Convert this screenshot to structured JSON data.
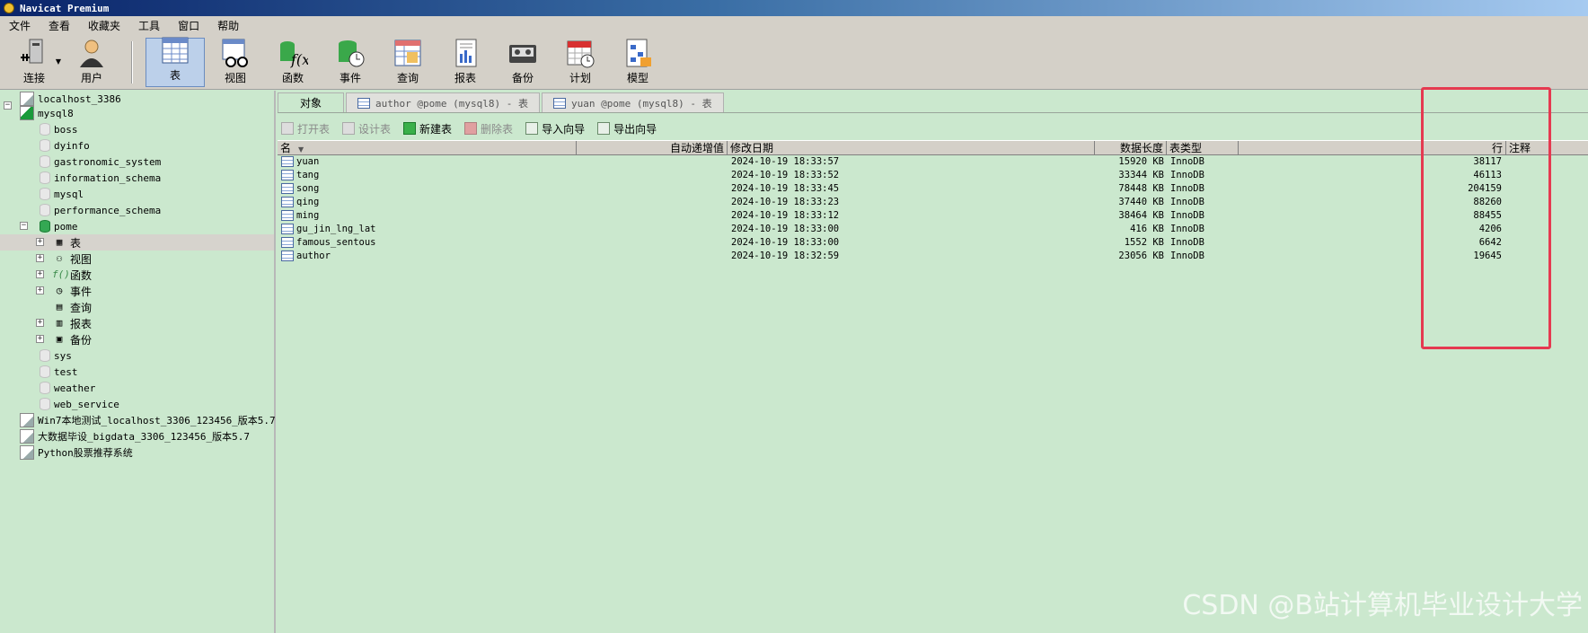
{
  "window": {
    "title": "Navicat Premium"
  },
  "menu": [
    "文件",
    "查看",
    "收藏夹",
    "工具",
    "窗口",
    "帮助"
  ],
  "toolbar": {
    "buttons": [
      {
        "label": "连接",
        "icon": "connection-icon"
      },
      {
        "label": "用户",
        "icon": "user-icon"
      },
      {
        "label": "表",
        "icon": "table-icon"
      },
      {
        "label": "视图",
        "icon": "view-icon"
      },
      {
        "label": "函数",
        "icon": "function-icon"
      },
      {
        "label": "事件",
        "icon": "event-icon"
      },
      {
        "label": "查询",
        "icon": "query-icon"
      },
      {
        "label": "报表",
        "icon": "report-icon"
      },
      {
        "label": "备份",
        "icon": "backup-icon"
      },
      {
        "label": "计划",
        "icon": "schedule-icon"
      },
      {
        "label": "模型",
        "icon": "model-icon"
      }
    ],
    "active": "表"
  },
  "sidebar": {
    "connections": [
      {
        "label": "localhost_3386"
      },
      {
        "label": "mysql8"
      },
      {
        "label": "Win7本地测试_localhost_3306_123456_版本5.7"
      },
      {
        "label": "大数据毕设_bigdata_3306_123456_版本5.7"
      },
      {
        "label": "Python股票推荐系统"
      }
    ],
    "databases": [
      "boss",
      "dyinfo",
      "gastronomic_system",
      "information_schema",
      "mysql",
      "performance_schema",
      "pome",
      "sys",
      "test",
      "weather",
      "web_service"
    ],
    "pome_children": [
      "表",
      "视图",
      "函数",
      "事件",
      "查询",
      "报表",
      "备份"
    ]
  },
  "tabs": {
    "objects": "对象",
    "tab1": "author @pome (mysql8) - 表",
    "tab2": "yuan @pome (mysql8) - 表"
  },
  "object_toolbar": {
    "open": "打开表",
    "design": "设计表",
    "new": "新建表",
    "delete": "删除表",
    "import": "导入向导",
    "export": "导出向导"
  },
  "grid": {
    "headers": {
      "name": "名",
      "auto_inc": "自动递增值",
      "modified": "修改日期",
      "data_length": "数据长度",
      "engine": "表类型",
      "rows": "行",
      "comment": "注释"
    },
    "rows": [
      {
        "name": "yuan",
        "modified": "2024-10-19 18:33:57",
        "data_length": "15920 KB",
        "engine": "InnoDB",
        "rows": "38117"
      },
      {
        "name": "tang",
        "modified": "2024-10-19 18:33:52",
        "data_length": "33344 KB",
        "engine": "InnoDB",
        "rows": "46113"
      },
      {
        "name": "song",
        "modified": "2024-10-19 18:33:45",
        "data_length": "78448 KB",
        "engine": "InnoDB",
        "rows": "204159"
      },
      {
        "name": "qing",
        "modified": "2024-10-19 18:33:23",
        "data_length": "37440 KB",
        "engine": "InnoDB",
        "rows": "88260"
      },
      {
        "name": "ming",
        "modified": "2024-10-19 18:33:12",
        "data_length": "38464 KB",
        "engine": "InnoDB",
        "rows": "88455"
      },
      {
        "name": "gu_jin_lng_lat",
        "modified": "2024-10-19 18:33:00",
        "data_length": "416 KB",
        "engine": "InnoDB",
        "rows": "4206"
      },
      {
        "name": "famous_sentous",
        "modified": "2024-10-19 18:33:00",
        "data_length": "1552 KB",
        "engine": "InnoDB",
        "rows": "6642"
      },
      {
        "name": "author",
        "modified": "2024-10-19 18:32:59",
        "data_length": "23056 KB",
        "engine": "InnoDB",
        "rows": "19645"
      }
    ]
  },
  "watermark": "CSDN @B站计算机毕业设计大学",
  "colors": {
    "background": "#cbe8ce",
    "highlight": "#e53950",
    "chrome": "#d4d0c8"
  }
}
